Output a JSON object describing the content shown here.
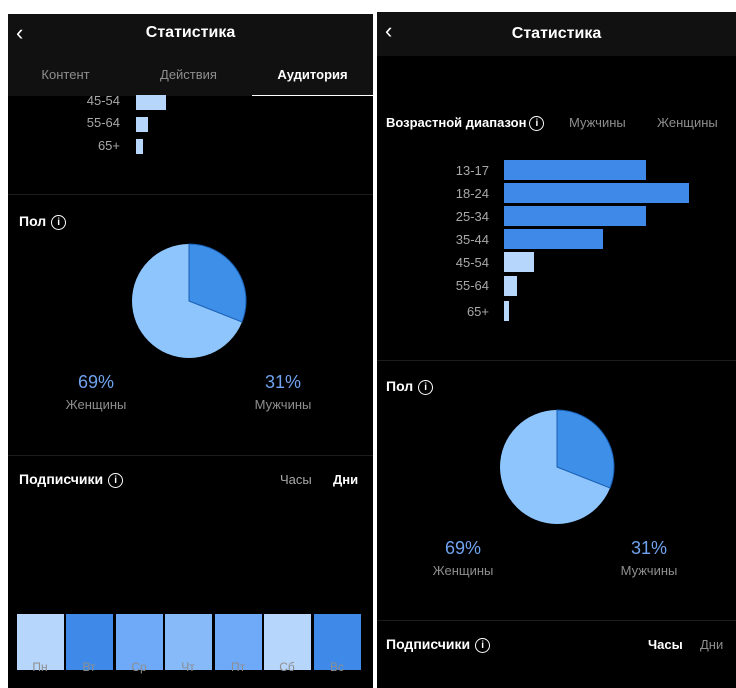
{
  "left": {
    "back_icon": "chevron-left-icon",
    "title": "Статистика",
    "tabs": [
      {
        "label": "Контент",
        "active": false
      },
      {
        "label": "Действия",
        "active": false
      },
      {
        "label": "Аудитория",
        "active": true
      }
    ],
    "age_rows": [
      {
        "label": "45-54",
        "value": 13
      },
      {
        "label": "55-64",
        "value": 5
      },
      {
        "label": "65+",
        "value": 3
      }
    ],
    "gender": {
      "title": "Пол",
      "info_icon": "info-icon",
      "women_pct": "69%",
      "women_label": "Женщины",
      "men_pct": "31%",
      "men_label": "Мужчины",
      "women_fraction": 0.69,
      "men_fraction": 0.31
    },
    "followers": {
      "title": "Подписчики",
      "info_icon": "info-icon",
      "hours_label": "Часы",
      "days_label": "Дни",
      "days": [
        "Пн",
        "Вт",
        "Ср",
        "Чт",
        "Пт",
        "Сб",
        "Вс"
      ],
      "day_colors": [
        "#b7d6fb",
        "#3f8ae9",
        "#6eaaf7",
        "#86baf9",
        "#6eaaf7",
        "#b7d6fb",
        "#3f8ae9"
      ]
    }
  },
  "right": {
    "back_icon": "chevron-left-icon",
    "title": "Статистика",
    "age_header": "Возрастной диапазон",
    "age_toggle": {
      "men": "Мужчины",
      "women": "Женщины"
    },
    "age_rows": [
      {
        "label": "13-17",
        "value": 33
      },
      {
        "label": "18-24",
        "value": 43
      },
      {
        "label": "25-34",
        "value": 33
      },
      {
        "label": "35-44",
        "value": 23
      },
      {
        "label": "45-54",
        "value": 7
      },
      {
        "label": "55-64",
        "value": 3
      },
      {
        "label": "65+",
        "value": 1
      }
    ],
    "gender": {
      "title": "Пол",
      "info_icon": "info-icon",
      "women_pct": "69%",
      "women_label": "Женщины",
      "men_pct": "31%",
      "men_label": "Мужчины",
      "women_fraction": 0.69,
      "men_fraction": 0.31
    },
    "followers": {
      "title": "Подписчики",
      "info_icon": "info-icon",
      "hours_label": "Часы",
      "days_label": "Дни"
    }
  },
  "colors": {
    "bar_dark": "#3f8ae9",
    "bar_light": "#b7d6fb",
    "pie_women": "#8ec5fc",
    "pie_men": "#3d8fe8",
    "pct_text": "#6fa3ef"
  }
}
